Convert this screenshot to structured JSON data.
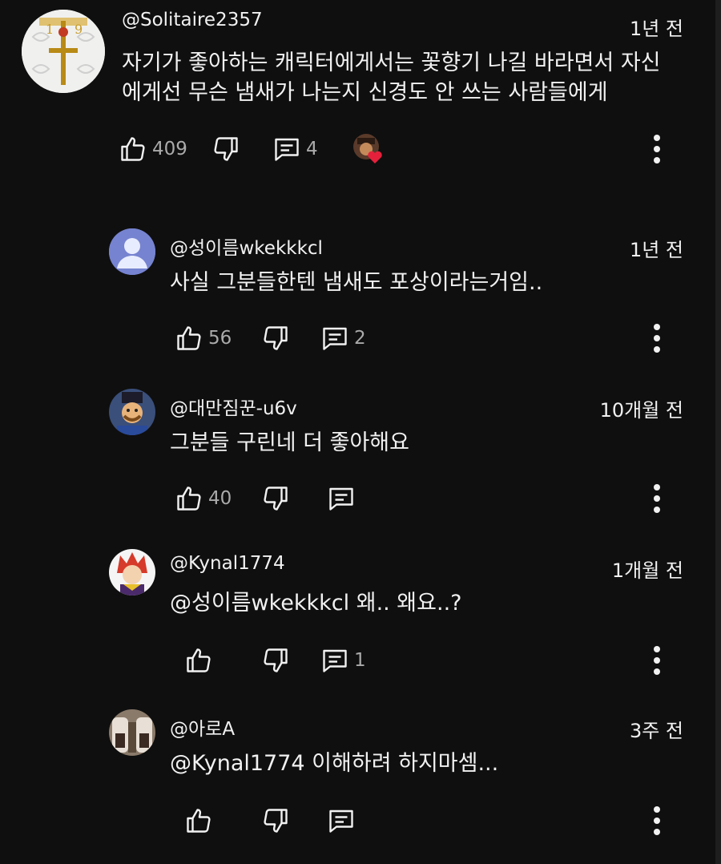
{
  "colors": {
    "background": "#0f0f0f",
    "text": "#f1f1f1",
    "muted": "#aaaaaa",
    "heart": "#e5203b"
  },
  "comments": [
    {
      "handle": "@Solitaire2357",
      "time": "1년 전",
      "text": "자기가 좋아하는 캐릭터에게서는 꽃향기 나길 바라면서 자신\n에게선 무슨 냄새가 나는지 신경도 안 쓰는 사람들에게",
      "likes": "409",
      "replies": "4",
      "creator_hearted": true
    },
    {
      "handle": "@성이름wkekkkcl",
      "time": "1년 전",
      "text": "사실 그분들한텐 냄새도 포상이라는거임..",
      "likes": "56",
      "replies": "2"
    },
    {
      "handle": "@대만짐꾼-u6v",
      "time": "10개월 전",
      "text": "그분들 구린네 더 좋아해요",
      "likes": "40",
      "replies": ""
    },
    {
      "handle": "@Kynal1774",
      "time": "1개월 전",
      "text": "@성이름wkekkkcl 왜.. 왜요..?",
      "likes": "",
      "replies": "1"
    },
    {
      "handle": "@아로A",
      "time": "3주 전",
      "text": "@Kynal1774 이해하려 하지마셈...",
      "likes": "",
      "replies": ""
    }
  ],
  "icons": {
    "like": "thumb-up-icon",
    "dislike": "thumb-down-icon",
    "reply": "comment-icon",
    "more": "more-vertical-icon"
  }
}
